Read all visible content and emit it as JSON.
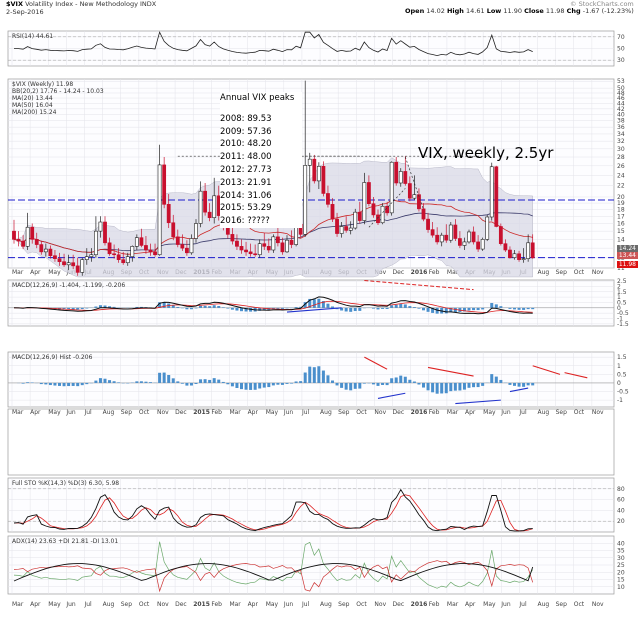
{
  "header": {
    "symbol": "$VIX",
    "name": "Volatility Index - New Methodology INDX",
    "date": "2-Sep-2016",
    "open_label": "Open",
    "open": "14.02",
    "high_label": "High",
    "high": "14.61",
    "low_label": "Low",
    "low": "11.90",
    "close_label": "Close",
    "close": "11.98",
    "chg_label": "Chg",
    "chg": "-1.67 (-12.23%)",
    "copyright": "© StockCharts.com"
  },
  "annotations": {
    "peaks_title": "Annual VIX peaks",
    "peaks": [
      "2008: 89.53",
      "2009: 57.36",
      "2010: 48.20",
      "2011: 48.00",
      "2012: 27.73",
      "2013: 21.91",
      "2014: 31.06",
      "2015: 53.29",
      "2016: ?????"
    ],
    "chart_title": "VIX, weekly, 2.5yr"
  },
  "panels": {
    "rsi": "RSI(14) 44.61",
    "price": "$VIX (Weekly) 11.98",
    "price_ma20": "MA(20) 13.44",
    "price_ma50": "MA(50) 16.04",
    "price_ma200": "MA(200) 15.24",
    "price_bb": "BB(20,2) 17.76 - 14.24 - 10.03",
    "macd": "MACD(12,26,9) -1.404, -1.199, -0.206",
    "hist": "MACD(12,26,9) Hist -0.206",
    "sto": "Full STO %K(14,3) %D(3) 6.30, 5.98",
    "adx": "ADX(14) 23.63 +DI 21.81 -DI 13.01"
  },
  "price_tags": {
    "last": "11.98",
    "ma20": "13.44",
    "bb": "14.24"
  },
  "chart_data": {
    "type": "candlestick",
    "title": "VIX, weekly, 2.5yr",
    "x_ticks": [
      "Mar",
      "Apr",
      "May",
      "Jun",
      "Jul",
      "Aug",
      "Sep",
      "Oct",
      "Nov",
      "Dec",
      "2015",
      "Feb",
      "Mar",
      "Apr",
      "May",
      "Jun",
      "Jul",
      "Aug",
      "Sep",
      "Oct",
      "Nov",
      "Dec",
      "2016",
      "Feb",
      "Mar",
      "Apr",
      "May",
      "Jun",
      "Jul",
      "Aug",
      "Sep",
      "Oct",
      "Nov"
    ],
    "price_y_ticks": [
      11,
      12,
      13,
      14,
      15,
      16,
      17,
      18,
      19,
      20,
      22,
      24,
      26,
      28,
      30,
      32,
      34,
      36,
      38,
      40,
      42,
      44,
      46,
      48,
      50,
      53
    ],
    "price_log_scale": true,
    "price_ylim": [
      11,
      54
    ],
    "rsi_y_ticks": [
      30,
      50,
      70
    ],
    "macd_y_ticks": [
      2.5,
      2.0,
      1.5,
      1.0,
      0.5,
      0.0,
      -0.5,
      -1.0,
      -1.5
    ],
    "hist_y_ticks": [
      1.5,
      1.0,
      0.5,
      0.0,
      -0.5,
      -1.0
    ],
    "sto_y_ticks": [
      20,
      40,
      60,
      80
    ],
    "adx_y_ticks": [
      10,
      15,
      20,
      25,
      30,
      35,
      40
    ],
    "horizontal_levels": [
      19.5,
      12.0
    ],
    "ohlc": [
      [
        15.0,
        16.5,
        13.5,
        14.0
      ],
      [
        14.0,
        15.0,
        13.2,
        13.8
      ],
      [
        13.8,
        14.5,
        12.9,
        13.2
      ],
      [
        13.2,
        17.5,
        12.8,
        15.5
      ],
      [
        15.5,
        16.0,
        13.5,
        14.0
      ],
      [
        14.0,
        14.8,
        13.0,
        13.4
      ],
      [
        13.4,
        13.8,
        12.3,
        12.6
      ],
      [
        12.6,
        13.5,
        12.1,
        12.9
      ],
      [
        12.9,
        13.3,
        11.9,
        12.2
      ],
      [
        12.2,
        12.8,
        11.6,
        11.9
      ],
      [
        11.9,
        12.5,
        11.2,
        11.6
      ],
      [
        11.6,
        12.4,
        11.1,
        11.3
      ],
      [
        11.3,
        12.3,
        10.8,
        11.5
      ],
      [
        11.5,
        12.3,
        10.9,
        11.2
      ],
      [
        11.2,
        12.0,
        10.3,
        10.6
      ],
      [
        10.6,
        12.0,
        10.3,
        11.8
      ],
      [
        11.8,
        13.0,
        11.3,
        12.1
      ],
      [
        12.1,
        13.0,
        11.6,
        12.3
      ],
      [
        12.3,
        17.0,
        12.0,
        15.0
      ],
      [
        15.0,
        17.0,
        14.2,
        16.2
      ],
      [
        16.2,
        17.0,
        13.3,
        13.6
      ],
      [
        13.6,
        14.2,
        12.2,
        12.4
      ],
      [
        12.4,
        13.4,
        11.9,
        12.3
      ],
      [
        12.3,
        13.0,
        11.5,
        11.8
      ],
      [
        11.8,
        12.6,
        11.3,
        11.5
      ],
      [
        11.5,
        12.5,
        11.2,
        12.1
      ],
      [
        12.1,
        13.3,
        11.6,
        13.2
      ],
      [
        13.2,
        14.6,
        12.8,
        14.2
      ],
      [
        14.2,
        15.3,
        13.1,
        13.3
      ],
      [
        13.3,
        14.4,
        12.4,
        12.8
      ],
      [
        12.8,
        13.5,
        12.2,
        12.6
      ],
      [
        12.6,
        13.5,
        12.1,
        12.3
      ],
      [
        12.3,
        31.06,
        12.2,
        26.2
      ],
      [
        26.2,
        28.0,
        18.2,
        18.8
      ],
      [
        18.8,
        20.5,
        15.4,
        16.1
      ],
      [
        16.1,
        17.2,
        13.9,
        14.3
      ],
      [
        14.3,
        15.2,
        13.1,
        13.4
      ],
      [
        13.4,
        14.6,
        12.7,
        13.0
      ],
      [
        13.0,
        13.9,
        12.2,
        12.5
      ],
      [
        12.5,
        14.6,
        12.3,
        14.1
      ],
      [
        14.1,
        16.6,
        13.6,
        16.0
      ],
      [
        16.0,
        22.8,
        15.5,
        21.0
      ],
      [
        21.0,
        22.5,
        17.1,
        17.6
      ],
      [
        17.6,
        19.0,
        16.3,
        16.8
      ],
      [
        16.8,
        23.5,
        16.0,
        20.2
      ],
      [
        20.2,
        22.0,
        16.4,
        17.1
      ],
      [
        17.1,
        17.8,
        15.1,
        15.6
      ],
      [
        15.6,
        16.5,
        14.1,
        14.6
      ],
      [
        14.6,
        15.5,
        13.4,
        13.8
      ],
      [
        13.8,
        14.6,
        12.8,
        13.2
      ],
      [
        13.2,
        14.0,
        12.4,
        12.8
      ],
      [
        12.8,
        13.7,
        12.2,
        12.6
      ],
      [
        12.6,
        13.5,
        12.1,
        12.4
      ],
      [
        12.4,
        13.4,
        12.1,
        12.3
      ],
      [
        12.3,
        14.0,
        12.0,
        13.5
      ],
      [
        13.5,
        14.8,
        12.8,
        13.2
      ],
      [
        13.2,
        14.1,
        12.5,
        12.8
      ],
      [
        12.8,
        14.6,
        12.5,
        14.3
      ],
      [
        14.3,
        15.6,
        13.2,
        13.6
      ],
      [
        13.6,
        14.2,
        12.3,
        12.6
      ],
      [
        12.6,
        14.5,
        12.5,
        13.9
      ],
      [
        13.9,
        15.1,
        13.0,
        13.4
      ],
      [
        13.4,
        16.6,
        13.2,
        15.9
      ],
      [
        15.9,
        18.0,
        14.2,
        14.6
      ],
      [
        14.6,
        53.29,
        14.3,
        26.1
      ],
      [
        26.1,
        29.0,
        20.8,
        27.5
      ],
      [
        27.5,
        28.5,
        22.4,
        22.9
      ],
      [
        22.9,
        26.8,
        21.4,
        25.9
      ],
      [
        25.9,
        27.0,
        20.1,
        20.6
      ],
      [
        20.6,
        22.0,
        18.3,
        18.8
      ],
      [
        18.8,
        19.8,
        16.2,
        16.6
      ],
      [
        16.6,
        17.5,
        14.3,
        14.7
      ],
      [
        14.7,
        16.2,
        14.2,
        15.6
      ],
      [
        15.6,
        17.0,
        14.8,
        15.1
      ],
      [
        15.1,
        16.3,
        14.6,
        15.4
      ],
      [
        15.4,
        18.1,
        15.2,
        17.6
      ],
      [
        17.6,
        19.2,
        16.0,
        16.4
      ],
      [
        16.4,
        24.5,
        15.9,
        22.6
      ],
      [
        22.6,
        24.0,
        18.5,
        18.9
      ],
      [
        18.9,
        20.0,
        16.8,
        17.2
      ],
      [
        17.2,
        18.0,
        15.8,
        16.1
      ],
      [
        16.1,
        19.0,
        15.9,
        18.5
      ],
      [
        18.5,
        19.2,
        17.1,
        17.5
      ],
      [
        17.5,
        27.0,
        17.1,
        26.8
      ],
      [
        26.8,
        28.0,
        22.0,
        22.5
      ],
      [
        22.5,
        25.5,
        21.8,
        24.8
      ],
      [
        24.8,
        28.2,
        22.0,
        22.4
      ],
      [
        22.4,
        23.8,
        19.3,
        19.8
      ],
      [
        19.8,
        24.0,
        19.5,
        20.4
      ],
      [
        20.4,
        21.5,
        17.7,
        18.1
      ],
      [
        18.1,
        19.0,
        16.3,
        16.6
      ],
      [
        16.6,
        17.5,
        14.8,
        15.2
      ],
      [
        15.2,
        16.2,
        14.2,
        14.5
      ],
      [
        14.5,
        15.5,
        13.4,
        13.7
      ],
      [
        13.7,
        14.8,
        13.2,
        14.5
      ],
      [
        14.5,
        15.9,
        13.6,
        13.9
      ],
      [
        13.9,
        16.2,
        13.6,
        15.8
      ],
      [
        15.8,
        16.6,
        13.8,
        14.1
      ],
      [
        14.1,
        15.0,
        13.0,
        13.3
      ],
      [
        13.3,
        14.2,
        12.8,
        13.7
      ],
      [
        13.7,
        15.2,
        13.5,
        14.9
      ],
      [
        14.9,
        15.6,
        13.4,
        13.7
      ],
      [
        13.7,
        14.5,
        12.6,
        12.9
      ],
      [
        12.9,
        14.2,
        12.7,
        14.0
      ],
      [
        14.0,
        17.2,
        13.8,
        16.9
      ],
      [
        16.9,
        26.7,
        16.4,
        25.8
      ],
      [
        25.8,
        26.0,
        15.5,
        15.6
      ],
      [
        15.6,
        16.0,
        13.3,
        13.5
      ],
      [
        13.5,
        14.0,
        12.6,
        12.8
      ],
      [
        12.8,
        13.2,
        11.9,
        12.0
      ],
      [
        12.0,
        12.8,
        11.8,
        12.4
      ],
      [
        12.4,
        12.7,
        11.6,
        11.8
      ],
      [
        11.8,
        13.0,
        11.5,
        11.9
      ],
      [
        11.9,
        14.6,
        11.6,
        13.6
      ],
      [
        13.6,
        14.61,
        11.9,
        11.98
      ]
    ],
    "rsi_last": 44.61,
    "macd_last": -1.404,
    "macd_signal_last": -1.199,
    "macd_hist_last": -0.206,
    "sto_k_last": 6.3,
    "sto_d_last": 5.98,
    "adx_last": 23.63,
    "plus_di_last": 21.81,
    "minus_di_last": 13.01
  }
}
